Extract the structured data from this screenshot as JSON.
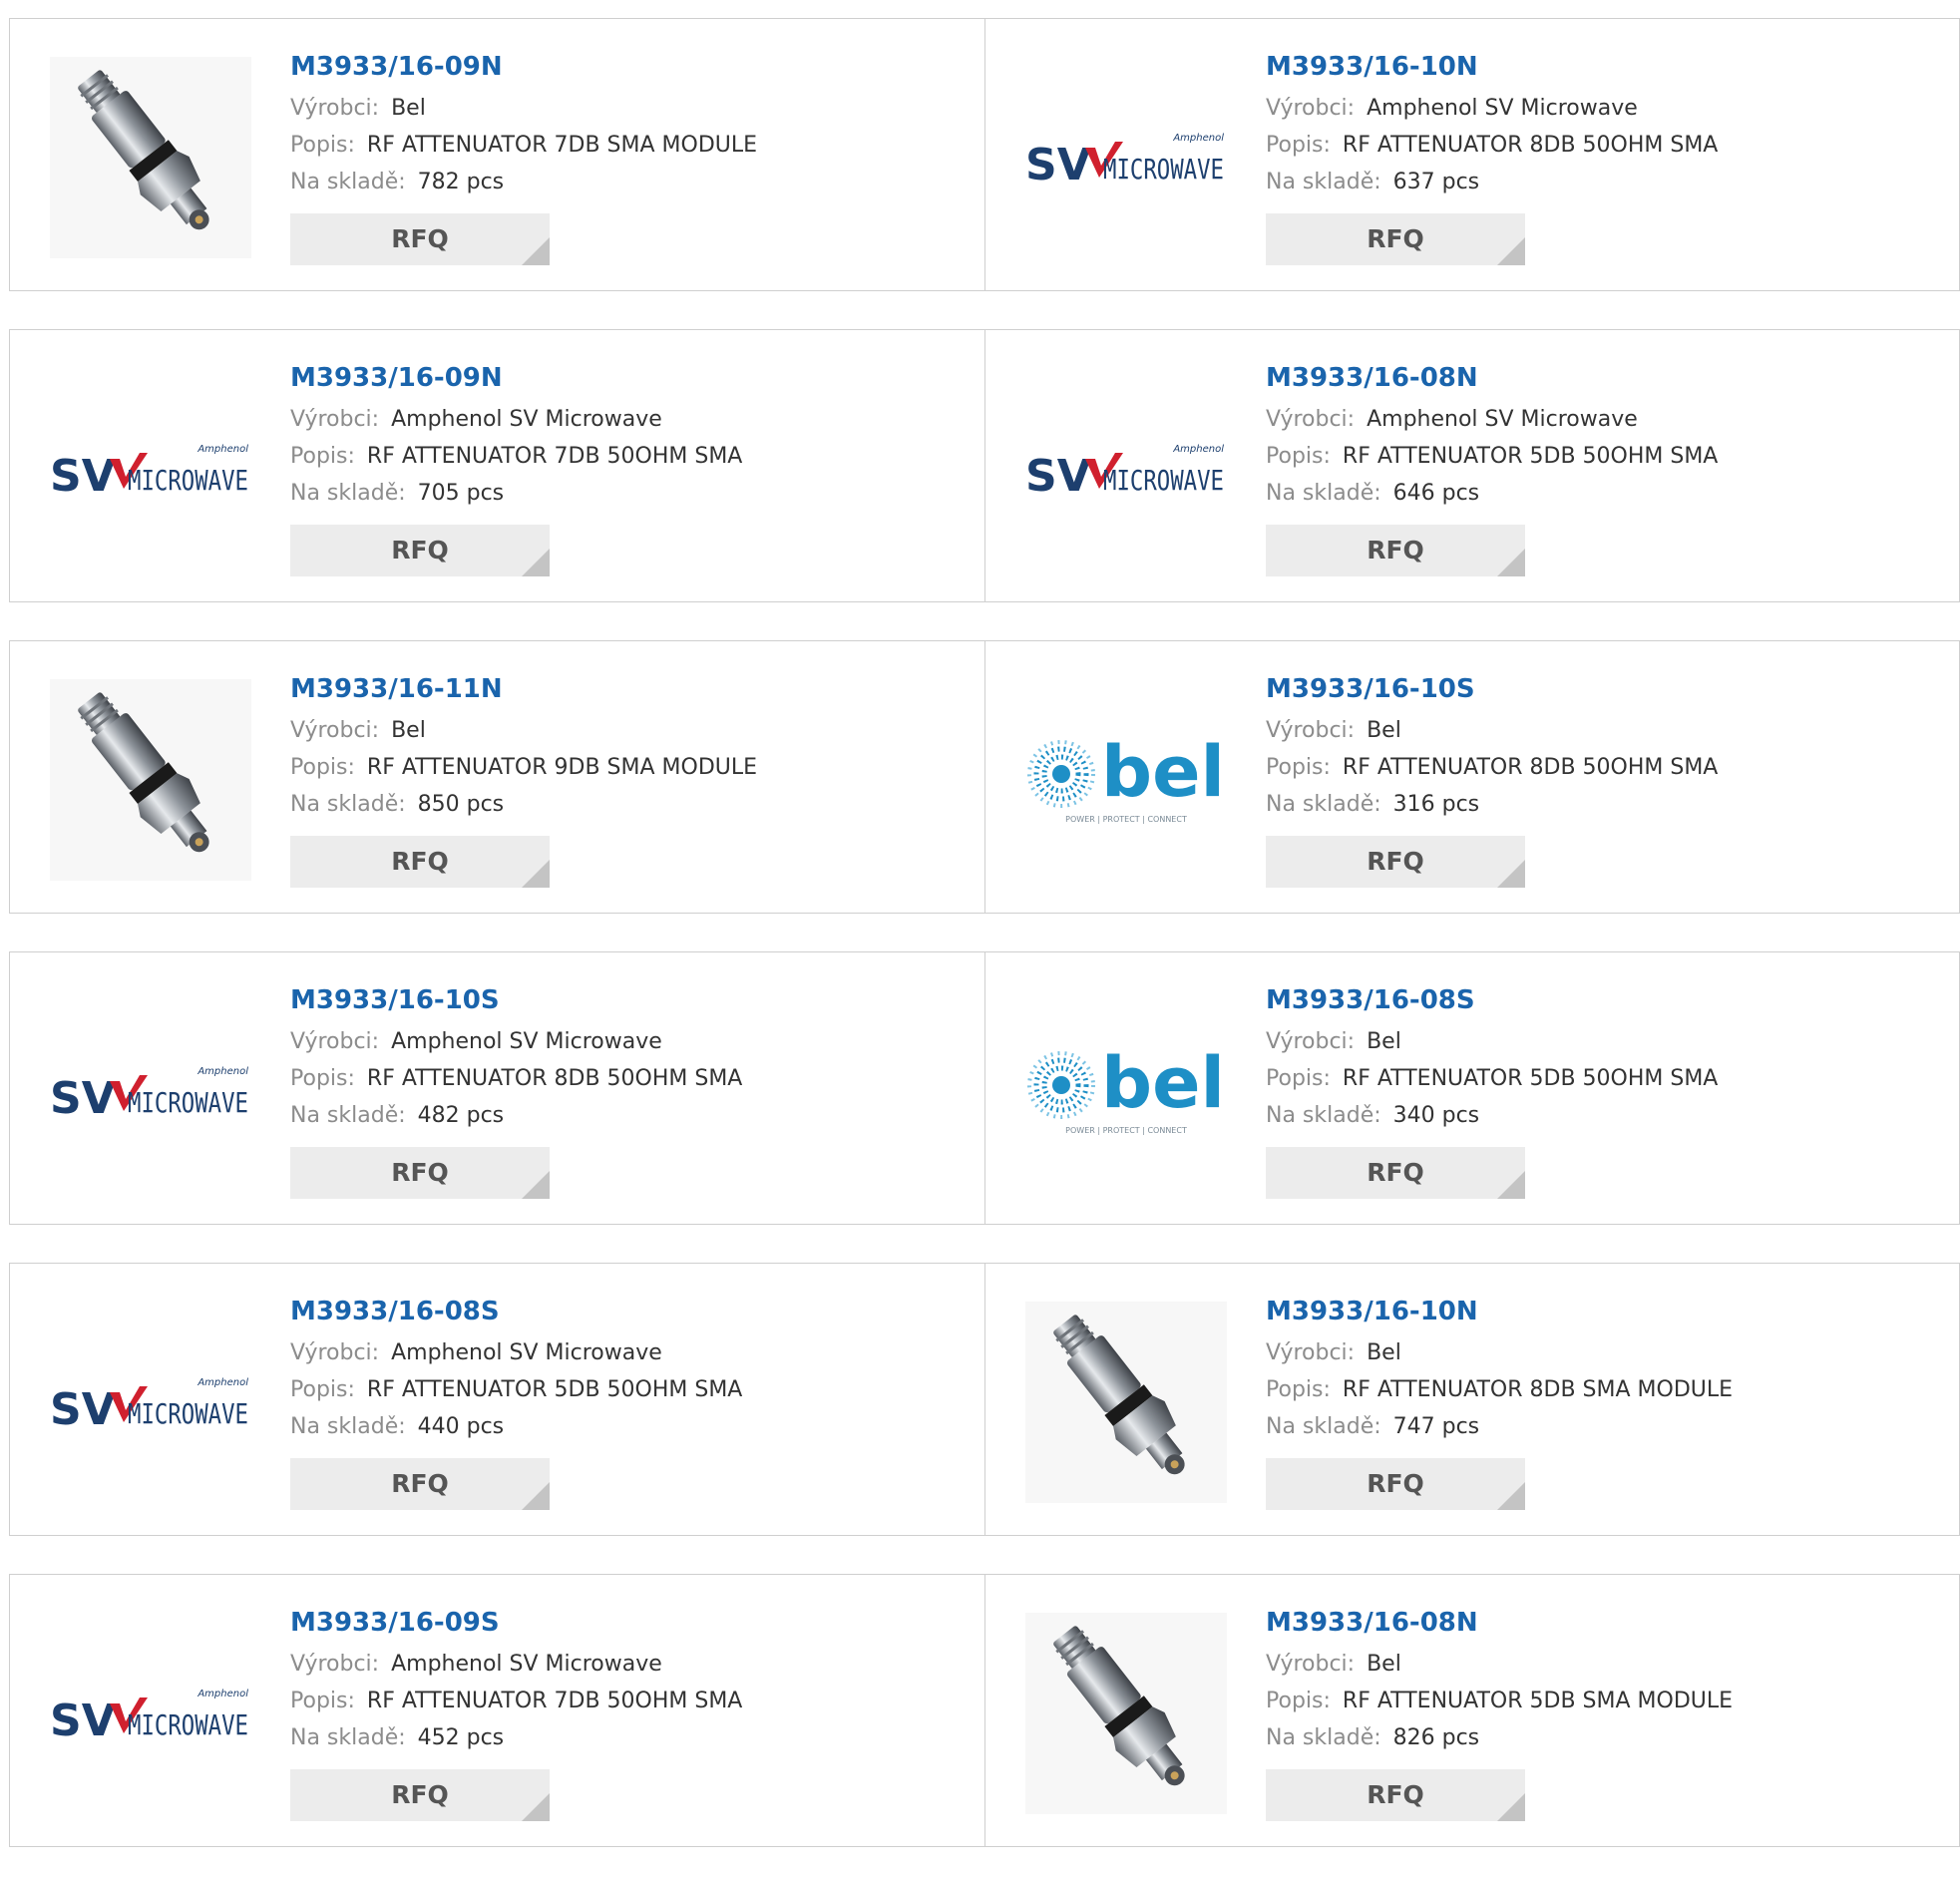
{
  "labels": {
    "manufacturer": "Výrobci:",
    "description": "Popis:",
    "stock": "Na skladě:",
    "rfq": "RFQ"
  },
  "logos": {
    "sv_small": "Amphenol",
    "sv_mark": "SV",
    "sv_word": "MICROWAVE",
    "bel_word": "bel",
    "bel_tagline": "POWER | PROTECT | CONNECT"
  },
  "products": [
    {
      "part": "M3933/16-09N",
      "manufacturer": "Bel",
      "description": "RF ATTENUATOR 7DB SMA MODULE",
      "stock": "782 pcs",
      "image": "attenuator-photo"
    },
    {
      "part": "M3933/16-10N",
      "manufacturer": "Amphenol SV Microwave",
      "description": "RF ATTENUATOR 8DB 50OHM SMA",
      "stock": "637 pcs",
      "image": "sv-microwave-logo"
    },
    {
      "part": "M3933/16-09N",
      "manufacturer": "Amphenol SV Microwave",
      "description": "RF ATTENUATOR 7DB 50OHM SMA",
      "stock": "705 pcs",
      "image": "sv-microwave-logo"
    },
    {
      "part": "M3933/16-08N",
      "manufacturer": "Amphenol SV Microwave",
      "description": "RF ATTENUATOR 5DB 50OHM SMA",
      "stock": "646 pcs",
      "image": "sv-microwave-logo"
    },
    {
      "part": "M3933/16-11N",
      "manufacturer": "Bel",
      "description": "RF ATTENUATOR 9DB SMA MODULE",
      "stock": "850 pcs",
      "image": "attenuator-photo"
    },
    {
      "part": "M3933/16-10S",
      "manufacturer": "Bel",
      "description": "RF ATTENUATOR 8DB 50OHM SMA",
      "stock": "316 pcs",
      "image": "bel-logo"
    },
    {
      "part": "M3933/16-10S",
      "manufacturer": "Amphenol SV Microwave",
      "description": "RF ATTENUATOR 8DB 50OHM SMA",
      "stock": "482 pcs",
      "image": "sv-microwave-logo"
    },
    {
      "part": "M3933/16-08S",
      "manufacturer": "Bel",
      "description": "RF ATTENUATOR 5DB 50OHM SMA",
      "stock": "340 pcs",
      "image": "bel-logo"
    },
    {
      "part": "M3933/16-08S",
      "manufacturer": "Amphenol SV Microwave",
      "description": "RF ATTENUATOR 5DB 50OHM SMA",
      "stock": "440 pcs",
      "image": "sv-microwave-logo"
    },
    {
      "part": "M3933/16-10N",
      "manufacturer": "Bel",
      "description": "RF ATTENUATOR 8DB SMA MODULE",
      "stock": "747 pcs",
      "image": "attenuator-photo"
    },
    {
      "part": "M3933/16-09S",
      "manufacturer": "Amphenol SV Microwave",
      "description": "RF ATTENUATOR 7DB 50OHM SMA",
      "stock": "452 pcs",
      "image": "sv-microwave-logo"
    },
    {
      "part": "M3933/16-08N",
      "manufacturer": "Bel",
      "description": "RF ATTENUATOR 5DB SMA MODULE",
      "stock": "826 pcs",
      "image": "attenuator-photo"
    }
  ],
  "colors": {
    "part_link": "#1a64ac",
    "sv_navy": "#1d3f6e",
    "sv_red": "#d0202e",
    "bel_blue": "#1e8fc6",
    "rfq_bg": "#ececec",
    "border": "#cfcfcf"
  }
}
